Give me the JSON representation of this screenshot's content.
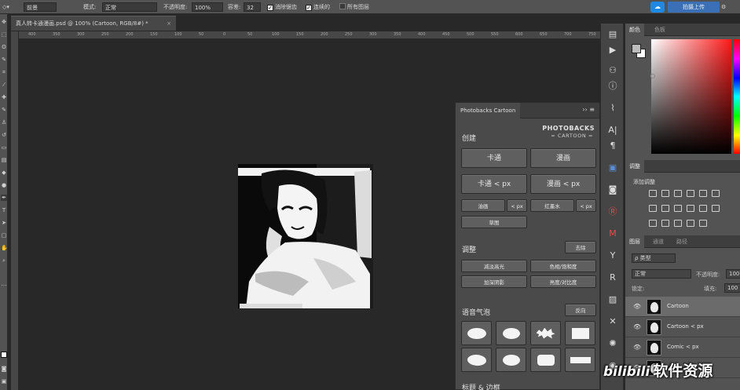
{
  "options_bar": {
    "preset_label": "前景",
    "mode_label": "模式:",
    "mode_value": "正常",
    "opacity_label": "不透明度:",
    "opacity_value": "100%",
    "tolerance_label": "容差:",
    "tolerance_value": "32",
    "antialias_label": "消除锯齿",
    "antialias_checked": true,
    "contiguous_label": "连续的",
    "contiguous_checked": true,
    "all_layers_label": "所有图层",
    "all_layers_checked": false,
    "share_label": "拍摄上传"
  },
  "document": {
    "tab_title": "真人转卡通漫画.psd @ 100% (Cartoon, RGB/8#) *",
    "close_symbol": "×",
    "ruler_labels": [
      "400",
      "350",
      "300",
      "250",
      "200",
      "150",
      "100",
      "50",
      "0",
      "50",
      "100",
      "150",
      "200",
      "250",
      "300",
      "350",
      "400",
      "450",
      "500",
      "550",
      "600",
      "650",
      "700",
      "750"
    ]
  },
  "photobacks_panel": {
    "tab_title": "Photobacks Cartoon",
    "menu_symbol": "›› ≡",
    "logo_line1": "PHOTOBACKS",
    "logo_line2": "= CARTOON =",
    "section_create": "创建",
    "btn_cartoon": "卡通",
    "btn_comic": "漫画",
    "btn_cartoon_px": "卡通 < px",
    "btn_comic_px": "漫画 < px",
    "btn_paint": "油画",
    "btn_paint_px": "< px",
    "btn_ink": "红墨水",
    "btn_ink_px": "< px",
    "btn_sketch": "草图",
    "section_adjust": "调整",
    "btn_remove": "去除",
    "btn_reduce_highlights": "减淡高光",
    "btn_hue_saturation": "色相/饱和度",
    "btn_deepen_shadows": "加深阴影",
    "btn_brightness_contrast": "亮度/对比度",
    "section_bubbles": "语音气泡",
    "btn_flip": "反向",
    "section_more": "标题 & 边框"
  },
  "right_panels": {
    "color_tab": "颜色",
    "swatches_tab": "色板",
    "adjustments_tab": "调整",
    "adjustments_title": "添加调整",
    "layers_tab": "图层",
    "channels_tab": "通道",
    "paths_tab": "路径",
    "filter_kind": "ρ 类型",
    "blend_mode": "正常",
    "opacity_label": "不透明度:",
    "opacity_value": "100",
    "lock_label": "锁定:",
    "fill_label": "填充:",
    "fill_value": "100",
    "layers": [
      {
        "name": "Cartoon",
        "selected": true
      },
      {
        "name": "Cartoon < px",
        "selected": false
      },
      {
        "name": "Comic < px",
        "selected": false
      }
    ]
  },
  "watermark": {
    "brand": "bilibili",
    "text": "软件资源"
  }
}
